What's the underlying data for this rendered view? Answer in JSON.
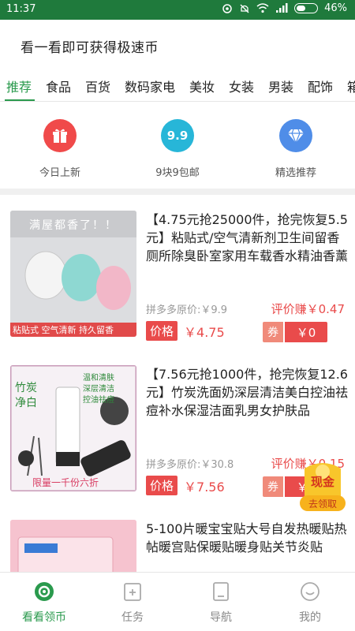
{
  "status_bar": {
    "time": "11:37",
    "battery": "46%",
    "battery_level": 0.46
  },
  "header": {
    "title": "看一看即可获得极速币"
  },
  "tabs": [
    {
      "label": "推荐",
      "active": true
    },
    {
      "label": "食品"
    },
    {
      "label": "百货"
    },
    {
      "label": "数码家电"
    },
    {
      "label": "美妆"
    },
    {
      "label": "女装"
    },
    {
      "label": "男装"
    },
    {
      "label": "配饰"
    },
    {
      "label": "箱"
    }
  ],
  "quick_entries": [
    {
      "label": "今日上新",
      "icon": "gift-icon",
      "color": "#f04a4a"
    },
    {
      "label": "9块9包邮",
      "icon": "nine-nine-icon",
      "color": "#27b6d8",
      "icon_text": "9.9"
    },
    {
      "label": "精选推荐",
      "icon": "diamond-icon",
      "color": "#4f8de8"
    }
  ],
  "products": [
    {
      "title": "【4.75元抢25000件，抢完恢复5.5元】粘贴式/空气清新剂卫生间留香厕所除臭卧室家用车载香水精油香薰",
      "orig_price": "拼多多原价:￥9.9",
      "eval_reward": "评价赚￥0.47",
      "price_tag": "价格",
      "price": "￥4.75",
      "coupon_label": "券",
      "coupon_value": "￥0",
      "thumb_text_top": "满屋都香了！！",
      "thumb_text_bottom": "粘贴式 空气清新 持久留香"
    },
    {
      "title": "【7.56元抢1000件，抢完恢复12.6元】竹炭洗面奶深层清洁美白控油祛痘补水保湿洁面乳男女护肤品",
      "orig_price": "拼多多原价:￥30.8",
      "eval_reward": "评价赚￥0.15",
      "price_tag": "价格",
      "price": "￥7.56",
      "coupon_label": "券",
      "coupon_value": "￥0",
      "thumb_text_left": "竹炭净白",
      "thumb_text_right": "温和清肤 深层清洁 控油祛痘",
      "thumb_text_bottom": "限量一千份六折"
    },
    {
      "title": "5-100片暖宝宝贴大号自发热暖贴热帖暖宫贴保暖贴暖身贴关节炎贴"
    }
  ],
  "float_badge": {
    "top": "现金",
    "bottom": "去领取"
  },
  "bottom_nav": [
    {
      "label": "看看领币",
      "icon": "coin-eye-icon",
      "active": true
    },
    {
      "label": "任务",
      "icon": "task-icon"
    },
    {
      "label": "导航",
      "icon": "navigation-icon"
    },
    {
      "label": "我的",
      "icon": "profile-icon"
    }
  ],
  "colors": {
    "brand_green": "#2a9a4d",
    "status_green": "#1f7a3c",
    "price_red": "#e94b4b"
  }
}
